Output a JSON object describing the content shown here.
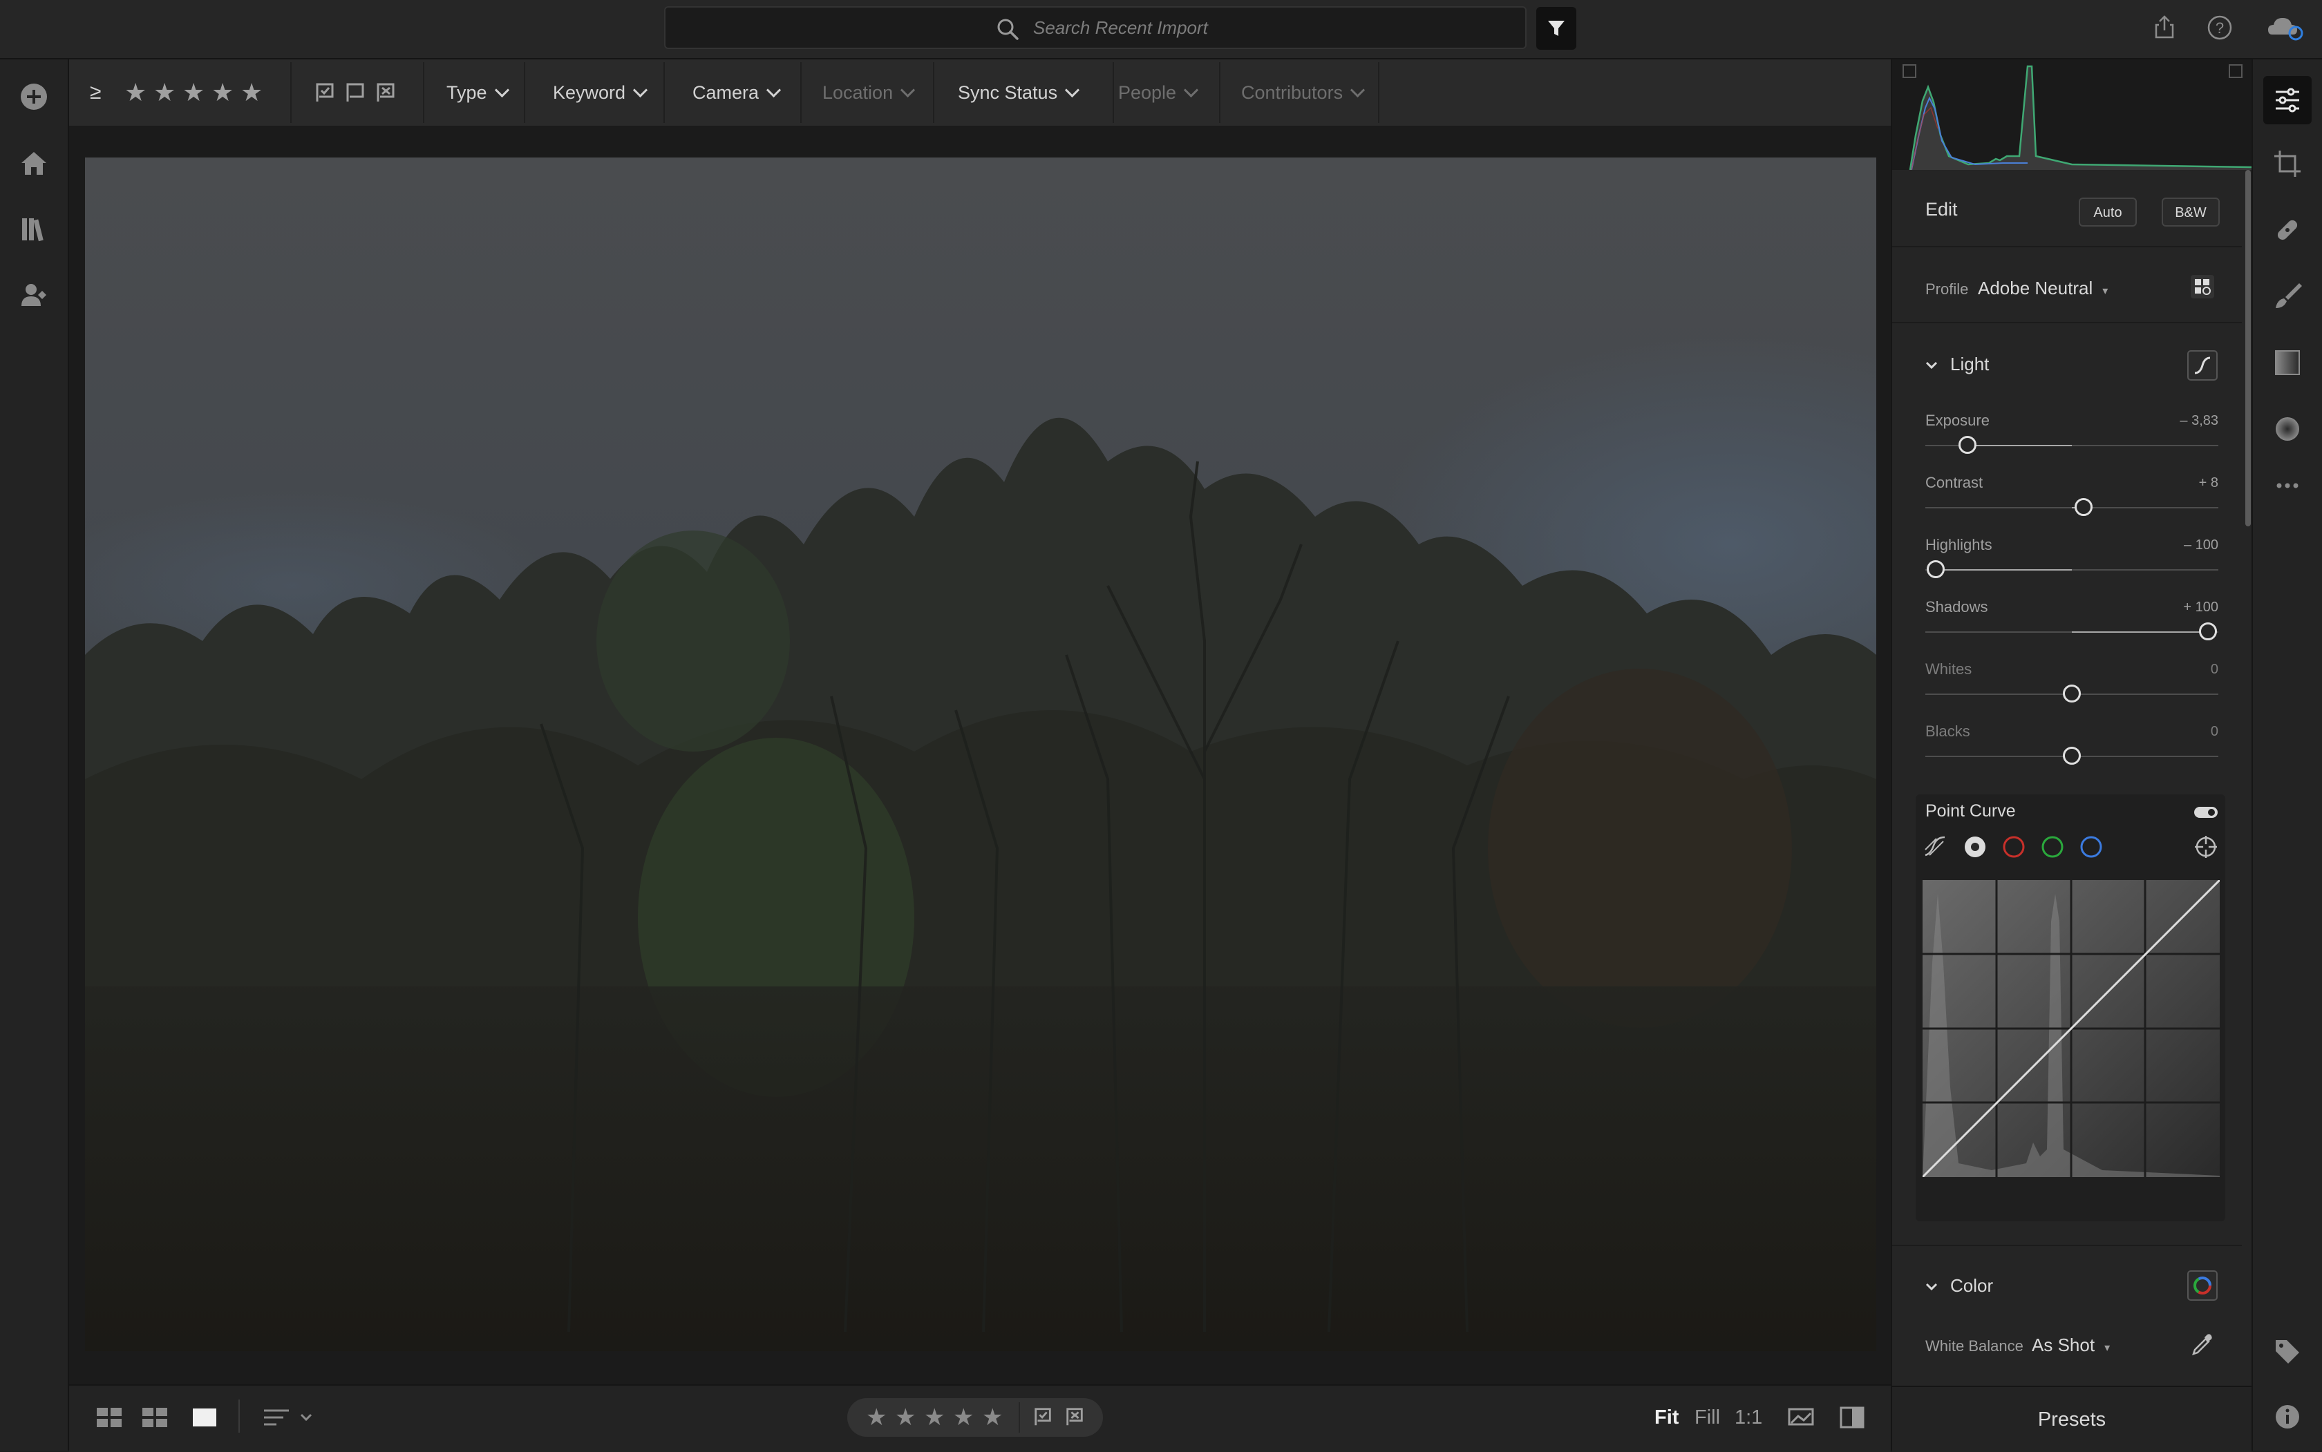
{
  "topbar": {
    "search_placeholder": "Search Recent Import",
    "icons": [
      "search-icon",
      "filter-icon",
      "share-icon",
      "help-icon",
      "cloud-sync-icon"
    ]
  },
  "left_rail": {
    "icons": [
      "add-photos-icon",
      "home-icon",
      "library-icon",
      "shared-people-icon"
    ]
  },
  "filterbar": {
    "rating_operator": "≥",
    "stars": [
      "★",
      "★",
      "★",
      "★",
      "★"
    ],
    "type": "Type",
    "keyword": "Keyword",
    "camera": "Camera",
    "location": "Location",
    "sync_status": "Sync Status",
    "people": "People",
    "contributors": "Contributors",
    "flag_icons": [
      "picked-flag-icon",
      "unflagged-icon",
      "rejected-flag-icon"
    ]
  },
  "bottombar": {
    "view_icons": [
      "square-grid-icon",
      "grid-icon",
      "detail-view-icon",
      "sort-icon"
    ],
    "stars": [
      "★",
      "★",
      "★",
      "★",
      "★"
    ],
    "fit": "Fit",
    "fill": "Fill",
    "one_to_one": "1:1",
    "compare_icons": [
      "photo-compare-icon",
      "before-after-icon"
    ]
  },
  "edit_panel": {
    "title": "Edit",
    "auto_button": "Auto",
    "bw_button": "B&W",
    "profile_label": "Profile",
    "profile_value": "Adobe Neutral",
    "light_title": "Light",
    "sliders": [
      {
        "label": "Exposure",
        "value": "– 3,83",
        "fraction": 0.145,
        "center": 0.5
      },
      {
        "label": "Contrast",
        "value": "+ 8",
        "fraction": 0.54,
        "center": 0.5
      },
      {
        "label": "Highlights",
        "value": "– 100",
        "fraction": 0.035,
        "center": 0.5
      },
      {
        "label": "Shadows",
        "value": "+ 100",
        "fraction": 0.965,
        "center": 0.5
      },
      {
        "label": "Whites",
        "value": "0",
        "fraction": 0.5,
        "center": 0.5
      },
      {
        "label": "Blacks",
        "value": "0",
        "fraction": 0.5,
        "center": 0.5
      }
    ],
    "point_curve_title": "Point Curve",
    "curve_channels": [
      "parametric-curve-icon",
      "rgb-channel-icon",
      "red-channel-icon",
      "green-channel-icon",
      "blue-channel-icon"
    ],
    "colors": {
      "red": "#c8302a",
      "green": "#2aa83c",
      "blue": "#3b7be0",
      "histogram_green": "#3fa873",
      "histogram_blue": "#4a7fd6"
    },
    "color_title": "Color",
    "white_balance_label": "White Balance",
    "white_balance_value": "As Shot",
    "presets": "Presets"
  },
  "tool_rail": {
    "icons": [
      "edit-sliders-icon",
      "crop-icon",
      "healing-icon",
      "brush-icon",
      "linear-gradient-icon",
      "radial-gradient-icon",
      "more-icon",
      "keyword-tag-icon",
      "info-icon"
    ]
  }
}
